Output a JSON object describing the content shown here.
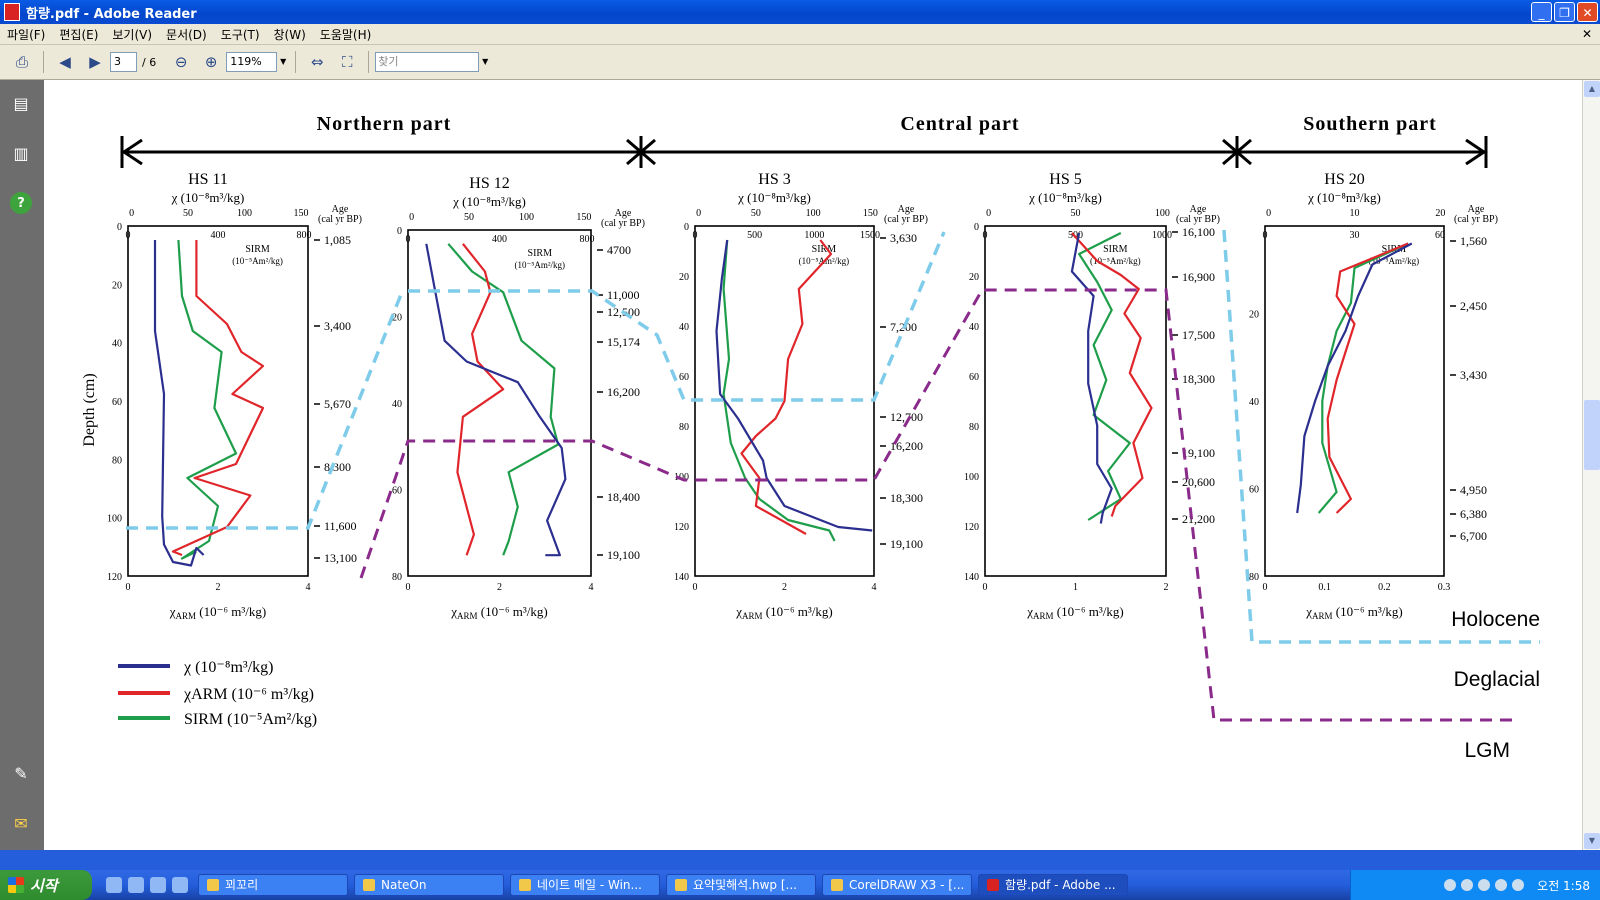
{
  "window": {
    "title": "함량.pdf - Adobe Reader"
  },
  "menu": [
    "파일(F)",
    "편집(E)",
    "보기(V)",
    "문서(D)",
    "도구(T)",
    "창(W)",
    "도움말(H)"
  ],
  "toolbar": {
    "page_current": "3",
    "page_total": "/ 6",
    "zoom": "119%",
    "find_placeholder": "찾기"
  },
  "figure": {
    "regions": {
      "north": "Northern part",
      "central": "Central part",
      "south": "Southern part"
    },
    "depth_label": "Depth (cm)",
    "age_header": [
      "Age",
      "(cal yr BP)"
    ],
    "sirm_header": [
      "SIRM",
      "(10⁻⁵Am²/kg)"
    ],
    "chi_axis_title": "χ (10⁻⁸m³/kg)",
    "chiarm_axis_title": "χ",
    "chiarm_sub": "ARM",
    "chiarm_unit": " (10⁻⁶ m³/kg)",
    "panels": [
      {
        "name": "HS 11",
        "chi_ticks": [
          "0",
          "50",
          "100",
          "150"
        ],
        "sirm_ticks": [
          "0",
          "400",
          "800"
        ],
        "arm_ticks": [
          "0",
          "2",
          "4"
        ],
        "depth_ticks": [
          "0",
          "20",
          "40",
          "60",
          "80",
          "100",
          "120"
        ],
        "ages": [
          "1,085",
          "3,400",
          "5,670",
          "8,300",
          "11,600",
          "13,100"
        ]
      },
      {
        "name": "HS 12",
        "chi_ticks": [
          "0",
          "50",
          "100",
          "150"
        ],
        "sirm_ticks": [
          "0",
          "400",
          "800"
        ],
        "arm_ticks": [
          "0",
          "2",
          "4"
        ],
        "depth_ticks": [
          "0",
          "20",
          "40",
          "60",
          "80"
        ],
        "ages": [
          "4700",
          "11,000",
          "12,500",
          "15,174",
          "16,200",
          "18,400",
          "19,100"
        ]
      },
      {
        "name": "HS 3",
        "chi_ticks": [
          "0",
          "50",
          "100",
          "150"
        ],
        "sirm_ticks": [
          "0",
          "500",
          "1000",
          "1500"
        ],
        "arm_ticks": [
          "0",
          "2",
          "4"
        ],
        "depth_ticks": [
          "0",
          "20",
          "40",
          "60",
          "80",
          "100",
          "120",
          "140"
        ],
        "ages": [
          "3,630",
          "7,200",
          "12,700",
          "16,200",
          "18,300",
          "19,100"
        ]
      },
      {
        "name": "HS 5",
        "chi_ticks": [
          "0",
          "50",
          "100"
        ],
        "sirm_ticks": [
          "0",
          "500",
          "1000"
        ],
        "arm_ticks": [
          "0",
          "1",
          "2"
        ],
        "depth_ticks": [
          "0",
          "20",
          "40",
          "60",
          "80",
          "100",
          "120",
          "140"
        ],
        "ages": [
          "16,100",
          "16,900",
          "17,500",
          "18,300",
          "19,100",
          "20,600",
          "21,200"
        ]
      },
      {
        "name": "HS 20",
        "chi_ticks": [
          "0",
          "10",
          "20"
        ],
        "sirm_ticks": [
          "0",
          "30",
          "60"
        ],
        "arm_ticks": [
          "0",
          "0.1",
          "0.2",
          "0.3"
        ],
        "depth_ticks": [
          "20",
          "40",
          "60",
          "80"
        ],
        "ages": [
          "1,560",
          "2,450",
          "3,430",
          "4,950",
          "6,380",
          "6,700"
        ]
      }
    ],
    "legend": [
      {
        "label": "χ (10⁻⁸m³/kg)",
        "color": "#2b2f8f"
      },
      {
        "label": "χARM (10⁻⁶ m³/kg)",
        "color": "#e0262b"
      },
      {
        "label": "SIRM (10⁻⁵Am²/kg)",
        "color": "#1e9e4a"
      }
    ],
    "periods": [
      "Holocene",
      "Deglacial",
      "LGM"
    ],
    "colors": {
      "holocene_line": "#7ecbea",
      "lgm_line": "#8a2a8a"
    }
  },
  "taskbar": {
    "start": "시작",
    "tasks": [
      "꾀꼬리",
      "NateOn",
      "네이트 메일 - Win...",
      "요약및해석.hwp [...",
      "CorelDRAW X3 - [...",
      "함량.pdf - Adobe ..."
    ],
    "clock": "오전 1:58"
  }
}
